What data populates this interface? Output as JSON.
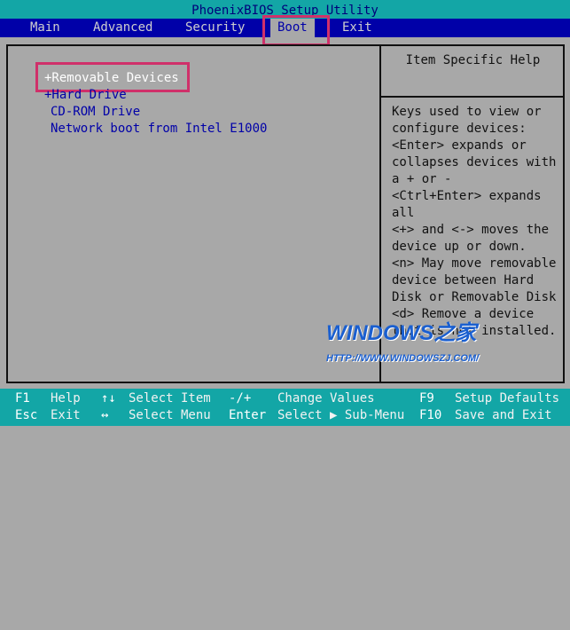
{
  "title": "PhoenixBIOS Setup Utility",
  "menu": [
    {
      "label": "Main"
    },
    {
      "label": "Advanced"
    },
    {
      "label": "Security"
    },
    {
      "label": "Boot",
      "selected": true
    },
    {
      "label": "Exit"
    }
  ],
  "boot_items": [
    "+Removable Devices",
    "+Hard Drive",
    "CD-ROM Drive",
    "Network boot from Intel E1000"
  ],
  "help": {
    "header": "Item Specific Help",
    "lines": [
      "Keys used to view or",
      "configure devices:",
      "<Enter> expands or",
      "collapses devices with",
      "a + or -",
      "<Ctrl+Enter> expands",
      "all",
      "<+> and <-> moves the",
      "device up or down.",
      "<n> May move removable",
      "device between Hard",
      "Disk or Removable Disk",
      "<d> Remove a device",
      "that is not installed."
    ]
  },
  "footer": [
    [
      {
        "key": "F1",
        "label": "Help"
      },
      {
        "key": "↑↓",
        "label": "Select Item"
      },
      {
        "key": "-/+",
        "label": "Change Values"
      },
      {
        "key": "F9",
        "label": "Setup Defaults"
      }
    ],
    [
      {
        "key": "Esc",
        "label": "Exit"
      },
      {
        "key": "↔",
        "label": "Select Menu"
      },
      {
        "key": "Enter",
        "label": "Select ▶ Sub-Menu"
      },
      {
        "key": "F10",
        "label": "Save and Exit"
      }
    ]
  ],
  "watermark": {
    "logo": "WINDOWS之家",
    "url": "HTTP://WWW.WINDOWSZJ.COM/"
  },
  "colors": {
    "title_bg": "#13a6a6",
    "menu_bg": "#0000a8",
    "panel_bg": "#a8a8a8",
    "highlight": "#d0306a"
  }
}
